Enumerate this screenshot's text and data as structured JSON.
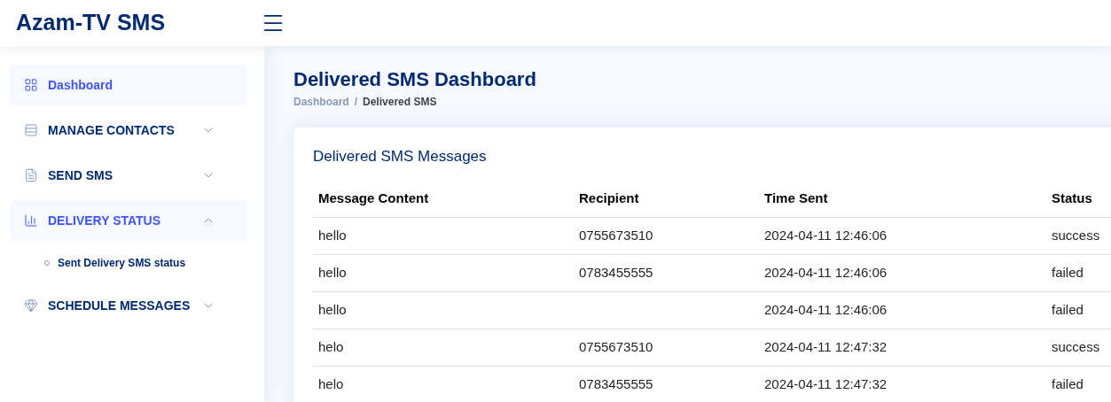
{
  "header": {
    "brand": "Azam-TV SMS"
  },
  "sidebar": {
    "items": [
      {
        "label": "Dashboard",
        "selected": true
      },
      {
        "label": "MANAGE CONTACTS",
        "selected": false,
        "expanded": false
      },
      {
        "label": "SEND SMS",
        "selected": false,
        "expanded": false
      },
      {
        "label": "DELIVERY STATUS",
        "selected": true,
        "expanded": true,
        "children": [
          {
            "label": "Sent Delivery SMS status"
          }
        ]
      },
      {
        "label": "SCHEDULE MESSAGES",
        "selected": false,
        "expanded": false
      }
    ]
  },
  "page": {
    "title": "Delivered SMS Dashboard",
    "breadcrumb": [
      "Dashboard",
      "Delivered SMS"
    ],
    "breadcrumb_separator": "/"
  },
  "card": {
    "title": "Delivered SMS Messages"
  },
  "table": {
    "columns": [
      "Message Content",
      "Recipient",
      "Time Sent",
      "Status"
    ],
    "rows": [
      [
        "hello",
        "0755673510",
        "2024-04-11 12:46:06",
        "success"
      ],
      [
        "hello",
        "0783455555",
        "2024-04-11 12:46:06",
        "failed"
      ],
      [
        "hello",
        "",
        "2024-04-11 12:46:06",
        "failed"
      ],
      [
        "helo",
        "0755673510",
        "2024-04-11 12:47:32",
        "success"
      ],
      [
        "helo",
        "0783455555",
        "2024-04-11 12:47:32",
        "failed"
      ]
    ]
  }
}
